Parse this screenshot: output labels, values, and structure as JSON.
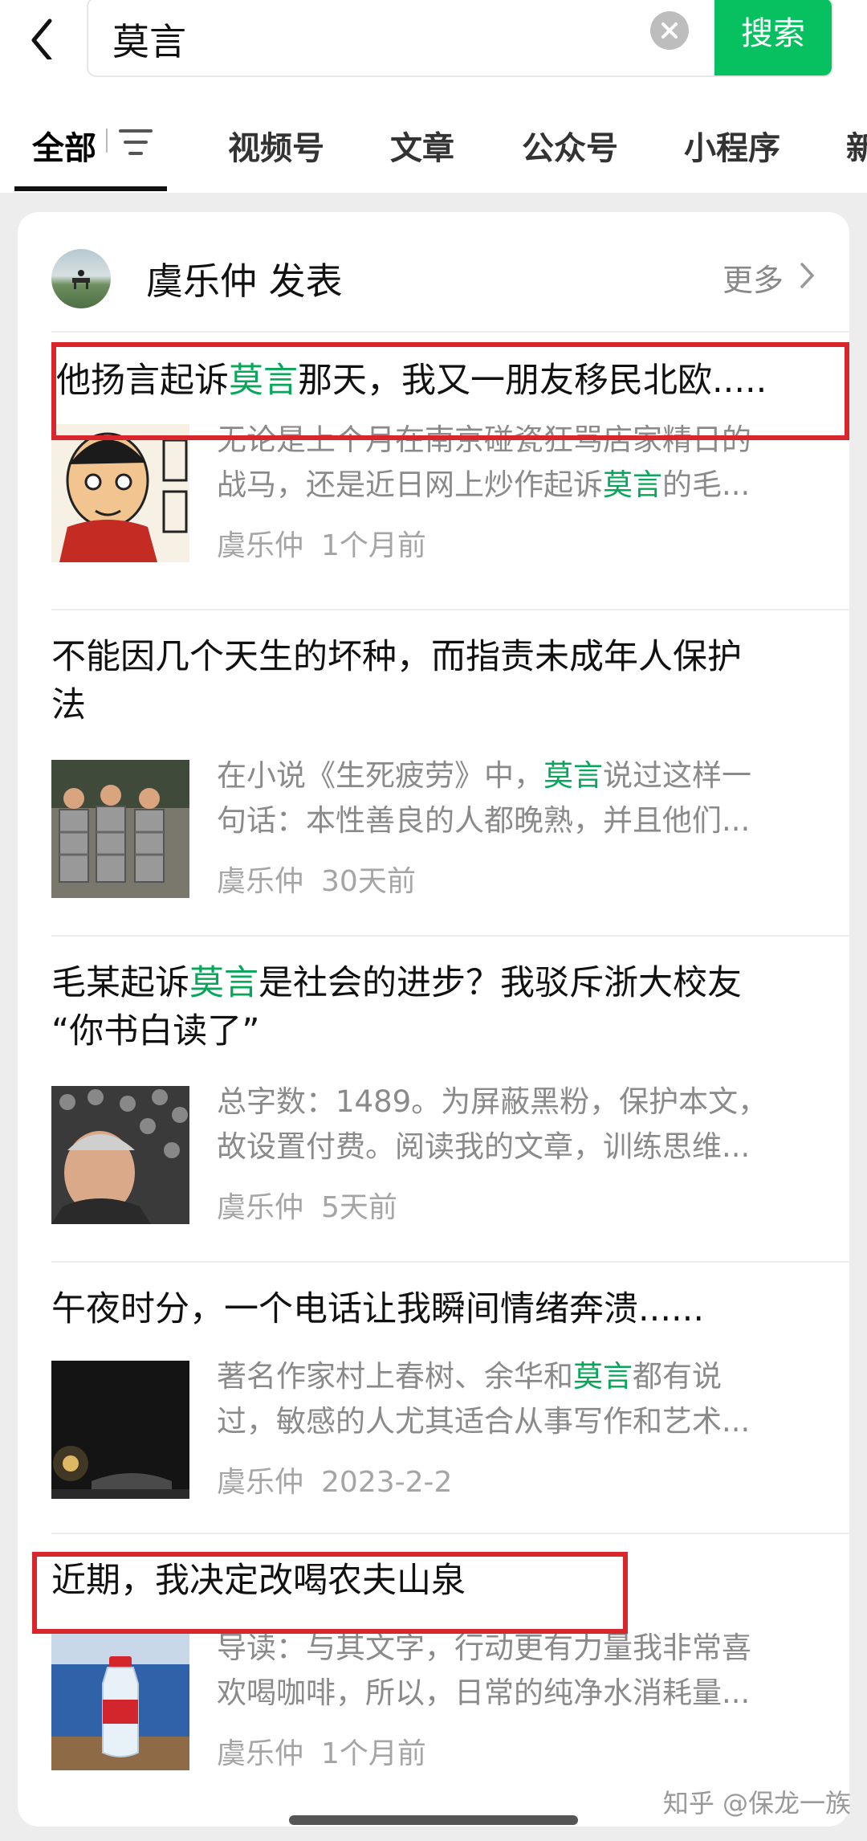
{
  "search": {
    "query": "莫言",
    "button_label": "搜索"
  },
  "tabs": [
    {
      "label": "全部",
      "active": true
    },
    {
      "label": "视频号"
    },
    {
      "label": "文章"
    },
    {
      "label": "公众号"
    },
    {
      "label": "小程序"
    },
    {
      "label": "新"
    }
  ],
  "account": {
    "name": "虞乐仲 发表",
    "more_label": "更多"
  },
  "results": [
    {
      "title_parts": [
        "他扬言起诉",
        "莫言",
        "那天，我又一朋友移民北欧....."
      ],
      "desc_line1": [
        "无论是上个月在南京碰瓷狂骂店家精日的"
      ],
      "desc_line2": [
        "战马，还是近日网上炒作起诉",
        "莫言",
        "的毛..."
      ],
      "source": "虞乐仲",
      "time": "1个月前"
    },
    {
      "title_line1": "不能因几个天生的坏种，而指责未成年人保护",
      "title_line2": "法",
      "desc_line1": [
        "在小说《生死疲劳》中，",
        "莫言",
        "说过这样一"
      ],
      "desc_line2": [
        "句话：本性善良的人都晚熟，并且他们..."
      ],
      "source": "虞乐仲",
      "time": "30天前"
    },
    {
      "title_line1_parts": [
        "毛某起诉",
        "莫言",
        "是社会的进步？我驳斥浙大校友"
      ],
      "title_line2": "“你书白读了”",
      "desc_line1": [
        "总字数：1489。为屏蔽黑粉，保护本文，"
      ],
      "desc_line2": [
        "故设置付费。阅读我的文章，训练思维..."
      ],
      "source": "虞乐仲",
      "time": "5天前"
    },
    {
      "title": "午夜时分，一个电话让我瞬间情绪奔溃......",
      "desc_line1": [
        "著名作家村上春树、余华和",
        "莫言",
        "都有说"
      ],
      "desc_line2": [
        "过，敏感的人尤其适合从事写作和艺术..."
      ],
      "source": "虞乐仲",
      "time": "2023-2-2"
    },
    {
      "title": "近期，我决定改喝农夫山泉",
      "desc_line1": [
        "导读：与其文字，行动更有力量我非常喜"
      ],
      "desc_line2": [
        "欢喝咖啡，所以，日常的纯净水消耗量..."
      ],
      "source": "虞乐仲",
      "time": "1个月前"
    }
  ],
  "watermark": "知乎 @保龙一族",
  "colors": {
    "accent": "#07c160",
    "highlight": "#07a65a",
    "annotation_red": "#d9262c"
  }
}
